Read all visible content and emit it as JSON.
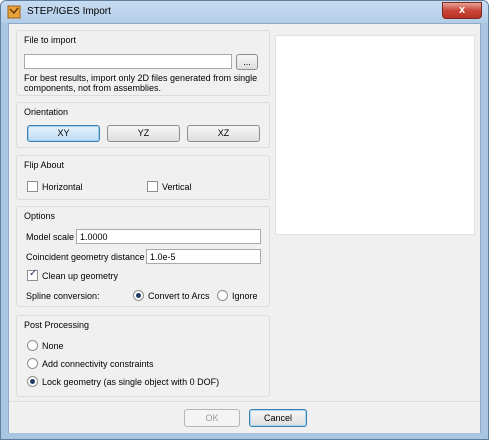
{
  "window": {
    "title": "STEP/IGES Import",
    "close_label": "x"
  },
  "file_group": {
    "title": "File to import",
    "input_value": "",
    "browse_label": "...",
    "note": "For best results, import only 2D files generated from single components, not from assemblies."
  },
  "orientation": {
    "title": "Orientation",
    "buttons": [
      {
        "label": "XY",
        "selected": true
      },
      {
        "label": "YZ",
        "selected": false
      },
      {
        "label": "XZ",
        "selected": false
      }
    ]
  },
  "flip": {
    "title": "Flip About",
    "horizontal_label": "Horizontal",
    "horizontal_checked": false,
    "vertical_label": "Vertical",
    "vertical_checked": false
  },
  "options": {
    "title": "Options",
    "model_scale_label": "Model scale",
    "model_scale_value": "1.0000",
    "coincident_label": "Coincident geometry distance",
    "coincident_value": "1.0e-5",
    "cleanup_label": "Clean up geometry",
    "cleanup_checked": true,
    "spline_label": "Spline conversion:",
    "spline_options": [
      {
        "label": "Convert to Arcs",
        "checked": true
      },
      {
        "label": "Ignore",
        "checked": false
      }
    ]
  },
  "post_processing": {
    "title": "Post Processing",
    "options": [
      {
        "label": "None",
        "checked": false
      },
      {
        "label": "Add connectivity constraints",
        "checked": false
      },
      {
        "label": "Lock geometry (as single object with 0 DOF)",
        "checked": true
      }
    ]
  },
  "footer": {
    "ok_label": "OK",
    "ok_enabled": false,
    "cancel_label": "Cancel"
  }
}
